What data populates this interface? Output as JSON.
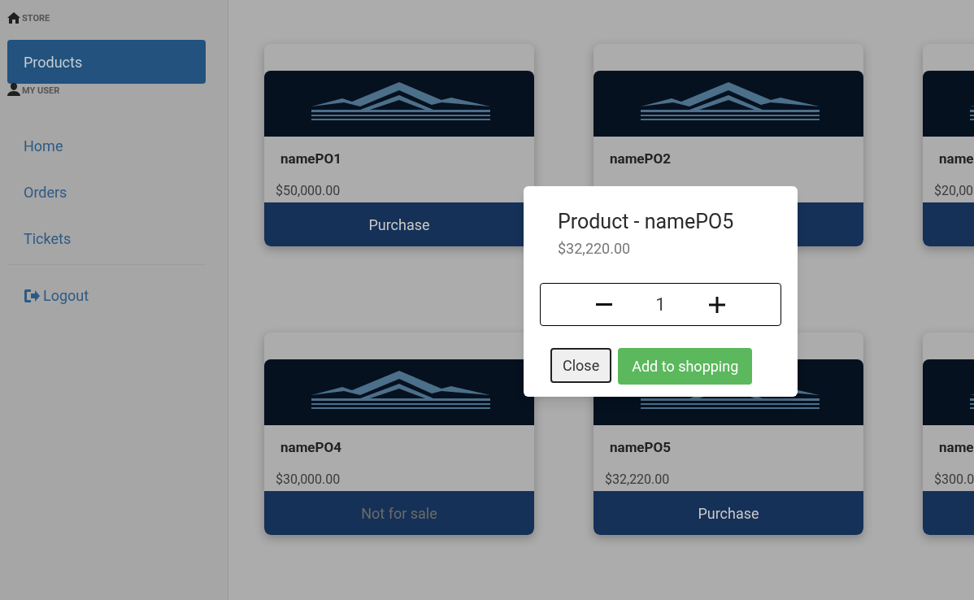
{
  "sidebar": {
    "sections": [
      {
        "kind": "store",
        "title": "STORE",
        "items": [
          {
            "label": "Products",
            "selected": true
          }
        ]
      },
      {
        "kind": "user",
        "title": "MY USER",
        "items": [
          {
            "label": "Home",
            "selected": false
          },
          {
            "label": "Orders",
            "selected": false
          },
          {
            "label": "Tickets",
            "selected": false
          }
        ]
      }
    ],
    "logout": "Logout"
  },
  "products": [
    {
      "name": "namePO1",
      "price": "$50,000.00",
      "button": {
        "label": "Purchase",
        "disabled": false
      }
    },
    {
      "name": "namePO2"
    },
    {
      "name": "name",
      "price": "$20,00"
    },
    {
      "name": "namePO4",
      "price": "$30,000.00",
      "button": {
        "label": "Not for sale",
        "disabled": true
      }
    },
    {
      "name": "namePO5",
      "price": "$32,220.00",
      "button": {
        "label": "Purchase",
        "disabled": false
      }
    },
    {
      "name": "name",
      "price": "$300.0"
    }
  ],
  "dialog": {
    "title": "Product - namePO5",
    "price": "$32,220.00",
    "quantity": "1",
    "buttons": [
      {
        "kind": "close",
        "label": "Close"
      },
      {
        "kind": "confirm",
        "label": "Add to shopping"
      }
    ]
  }
}
